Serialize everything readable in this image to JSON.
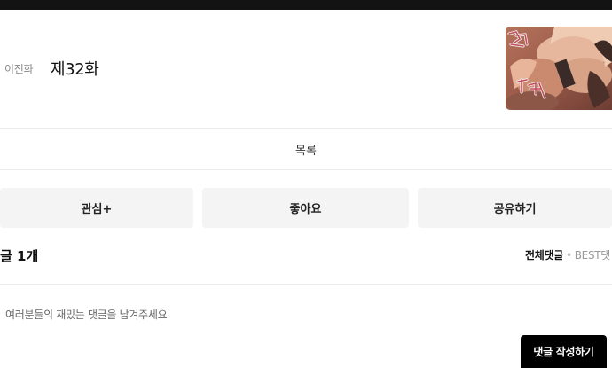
{
  "header": {
    "prev_label": "이전화",
    "episode_title": "제32화",
    "thumbnail_caption": "퍽 퍼어"
  },
  "nav": {
    "list_label": "목록"
  },
  "actions": {
    "subscribe_label": "관심+",
    "like_label": "좋아요",
    "share_label": "공유하기"
  },
  "comments": {
    "heading": "글 1개",
    "sort_all_label": "전체댓글",
    "sort_separator": "•",
    "sort_best_label": "BEST댓",
    "placeholder": "여러분들의 재밌는 댓글을 남겨주세요",
    "write_label": "댓글 작성하기"
  },
  "colors": {
    "topbar": "#131313",
    "button_bg": "#f4f4f4",
    "write_button_bg": "#000000"
  }
}
